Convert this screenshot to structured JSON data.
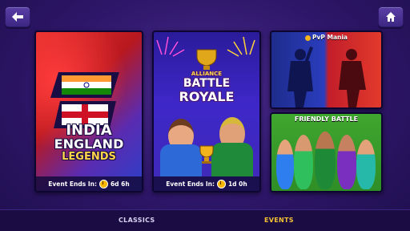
{
  "nav": {
    "back_icon": "back-arrow-icon",
    "home_icon": "home-icon"
  },
  "cards": {
    "india_england": {
      "title_line1": "INDIA",
      "title_line2": "ENGLAND",
      "title_line3": "LEGENDS",
      "event_label": "Event Ends In:",
      "countdown": "6d 6h"
    },
    "battle_royale": {
      "title_line1": "ALLIANCE",
      "title_line2": "BATTLE",
      "title_line3": "ROYALE",
      "event_label": "Event Ends In:",
      "countdown": "1d 0h"
    },
    "pvp": {
      "title": "PvP Mania"
    },
    "friendly": {
      "title": "FRIENDLY BATTLE"
    }
  },
  "tabs": {
    "classics": "CLASSICS",
    "events": "EVENTS",
    "active": "EVENTS"
  },
  "colors": {
    "active_tab": "#f4c233",
    "inactive_tab": "#d8d2f0",
    "background": "#2d1668"
  }
}
